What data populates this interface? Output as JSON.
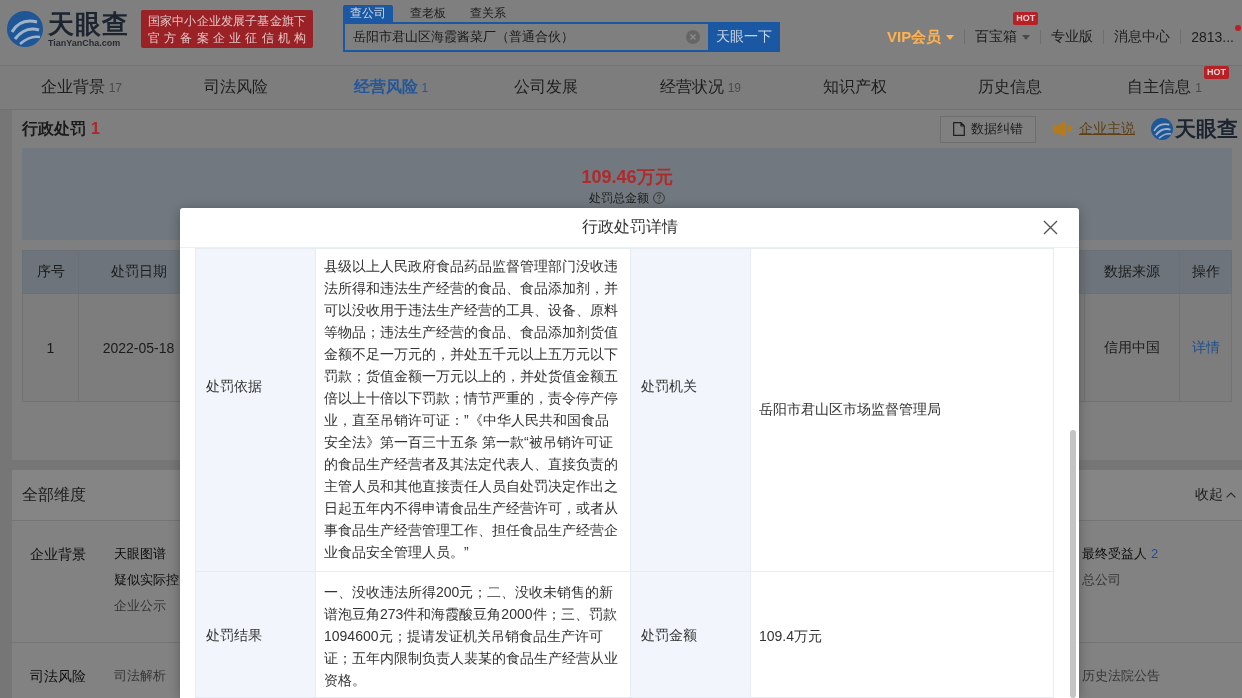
{
  "header": {
    "logo": {
      "name": "天眼查",
      "domain": "TianYanCha.com"
    },
    "slogan": [
      "国家中小企业发展子基金旗下",
      "官方备案企业征信机构"
    ],
    "search": {
      "tabs": [
        {
          "label": "查公司",
          "selected": true
        },
        {
          "label": "查老板",
          "selected": false
        },
        {
          "label": "查关系",
          "selected": false
        }
      ],
      "value": "岳阳市君山区海霞酱菜厂（普通合伙）",
      "button": "天眼一下"
    },
    "menu": [
      {
        "kind": "vip",
        "label": "VIP会员",
        "dropdown": true
      },
      {
        "kind": "link",
        "label": "百宝箱",
        "dropdown": true,
        "badge": "HOT"
      },
      {
        "kind": "link",
        "label": "专业版",
        "dropdown": false
      },
      {
        "kind": "link",
        "label": "消息中心",
        "dropdown": false
      },
      {
        "kind": "user",
        "label": "2813...",
        "dropdown": false,
        "unread": true
      }
    ]
  },
  "nav_tabs": [
    {
      "label": "企业背景",
      "count": "17",
      "selected": false
    },
    {
      "label": "司法风险",
      "selected": false
    },
    {
      "label": "经营风险",
      "count": "1",
      "selected": true
    },
    {
      "label": "公司发展",
      "selected": false
    },
    {
      "label": "经营状况",
      "count": "19",
      "selected": false
    },
    {
      "label": "知识产权",
      "selected": false
    },
    {
      "label": "历史信息",
      "selected": false
    },
    {
      "label": "自主信息",
      "count": "1",
      "selected": false,
      "badge": "HOT"
    }
  ],
  "penalty_section": {
    "title": "行政处罚",
    "count": "1",
    "actions": [
      {
        "kind": "button",
        "label": "数据纠错"
      },
      {
        "kind": "speaker",
        "label": "企业主说"
      },
      {
        "kind": "logo",
        "label": "天眼查"
      }
    ],
    "summary": {
      "amount": "109.46万元",
      "label": "处罚总金额"
    },
    "table": {
      "columns": [
        "序号",
        "处罚日期",
        "数据来源",
        "操作"
      ],
      "rows": [
        {
          "cells": [
            "1",
            "2022-05-18",
            "信用中国",
            "详情"
          ]
        }
      ]
    }
  },
  "dimensions": {
    "title": "全部维度",
    "toggle": "收起",
    "groups": [
      {
        "label": "企业背景",
        "left_items": [
          {
            "label": "天眼图谱",
            "disabled": false
          },
          {
            "label": "疑似实际控",
            "disabled": false
          },
          {
            "label": "企业公示",
            "disabled": true
          }
        ],
        "right_items": [
          {
            "label": "最终受益人",
            "count": "2",
            "disabled": false
          },
          {
            "label": "总公司",
            "disabled": true
          }
        ]
      },
      {
        "label": "司法风险",
        "left_items": [
          {
            "label": "司法解析",
            "disabled": true
          }
        ],
        "right_items": [
          {
            "label": "历史法院公告",
            "disabled": true
          }
        ]
      }
    ]
  },
  "dialog": {
    "title": "行政处罚详情",
    "rows": [
      {
        "label": "处罚依据",
        "text": "县级以上人民政府食品药品监督管理部门没收违法所得和违法生产经营的食品、食品添加剂，并可以没收用于违法生产经营的工具、设备、原料等物品；违法生产经营的食品、食品添加剂货值金额不足一万元的，并处五千元以上五万元以下罚款；货值金额一万元以上的，并处货值金额五倍以上十倍以下罚款；情节严重的，责令停产停业，直至吊销许可证：”《中华人民共和国食品安全法》第一百三十五条 第一款“被吊销许可证的食品生产经营者及其法定代表人、直接负责的主管人员和其他直接责任人员自处罚决定作出之日起五年内不得申请食品生产经营许可，或者从事食品生产经营管理工作、担任食品生产经营企业食品安全管理人员。”",
        "side_label": "处罚机关",
        "side_value": "岳阳市君山区市场监督管理局"
      },
      {
        "label": "处罚结果",
        "text": "一、没收违法所得200元；二、没收未销售的新谱泡豆角273件和海霞酸豆角2000件；三、罚款1094600元；提请发证机关吊销食品生产许可证；五年内限制负责人裴某的食品生产经营从业资格。",
        "side_label": "处罚金额",
        "side_value": "109.4万元"
      }
    ]
  }
}
